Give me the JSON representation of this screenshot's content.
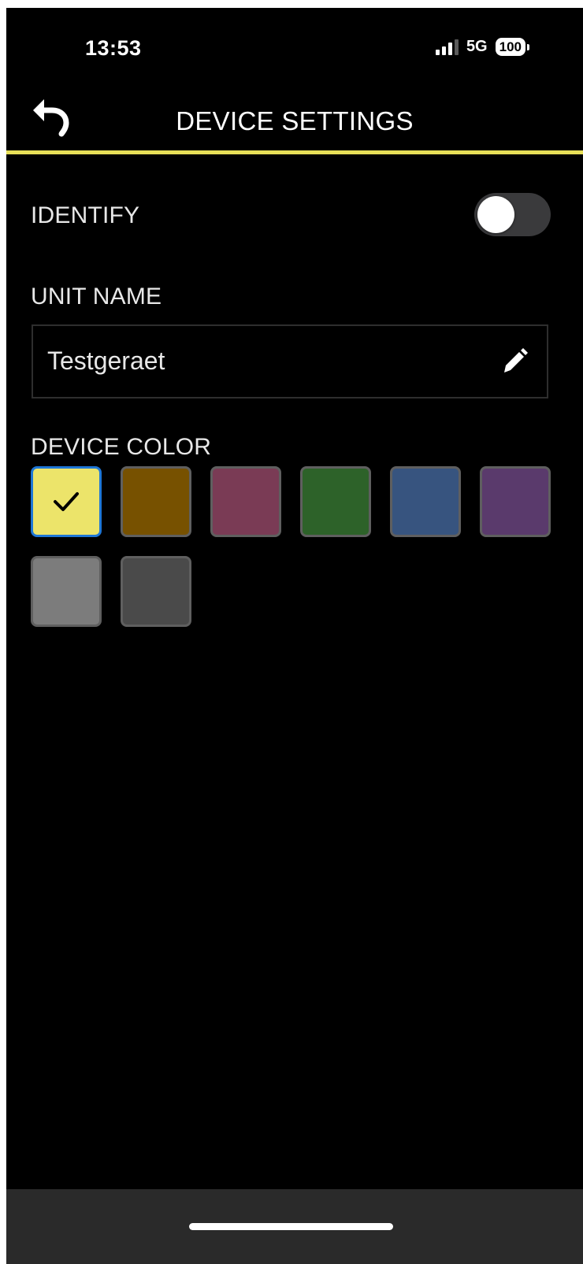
{
  "status_bar": {
    "time": "13:53",
    "network": "5G",
    "battery": "100"
  },
  "header": {
    "title": "DEVICE SETTINGS",
    "back_icon": "back-arrow-icon",
    "accent_color": "#e7df57"
  },
  "identify": {
    "label": "IDENTIFY",
    "toggle_on": false
  },
  "unit_name": {
    "label": "UNIT NAME",
    "value": "Testgeraet",
    "edit_icon": "pencil-icon"
  },
  "device_color": {
    "label": "DEVICE COLOR",
    "selected_index": 0,
    "swatches": [
      {
        "name": "yellow",
        "color": "#ece46a"
      },
      {
        "name": "brown",
        "color": "#775100"
      },
      {
        "name": "maroon",
        "color": "#7a3b55"
      },
      {
        "name": "green",
        "color": "#2d6229"
      },
      {
        "name": "blue",
        "color": "#37547f"
      },
      {
        "name": "purple",
        "color": "#5a3a6c"
      },
      {
        "name": "light-gray",
        "color": "#7c7c7c"
      },
      {
        "name": "dark-gray",
        "color": "#4a4a4a"
      }
    ]
  }
}
